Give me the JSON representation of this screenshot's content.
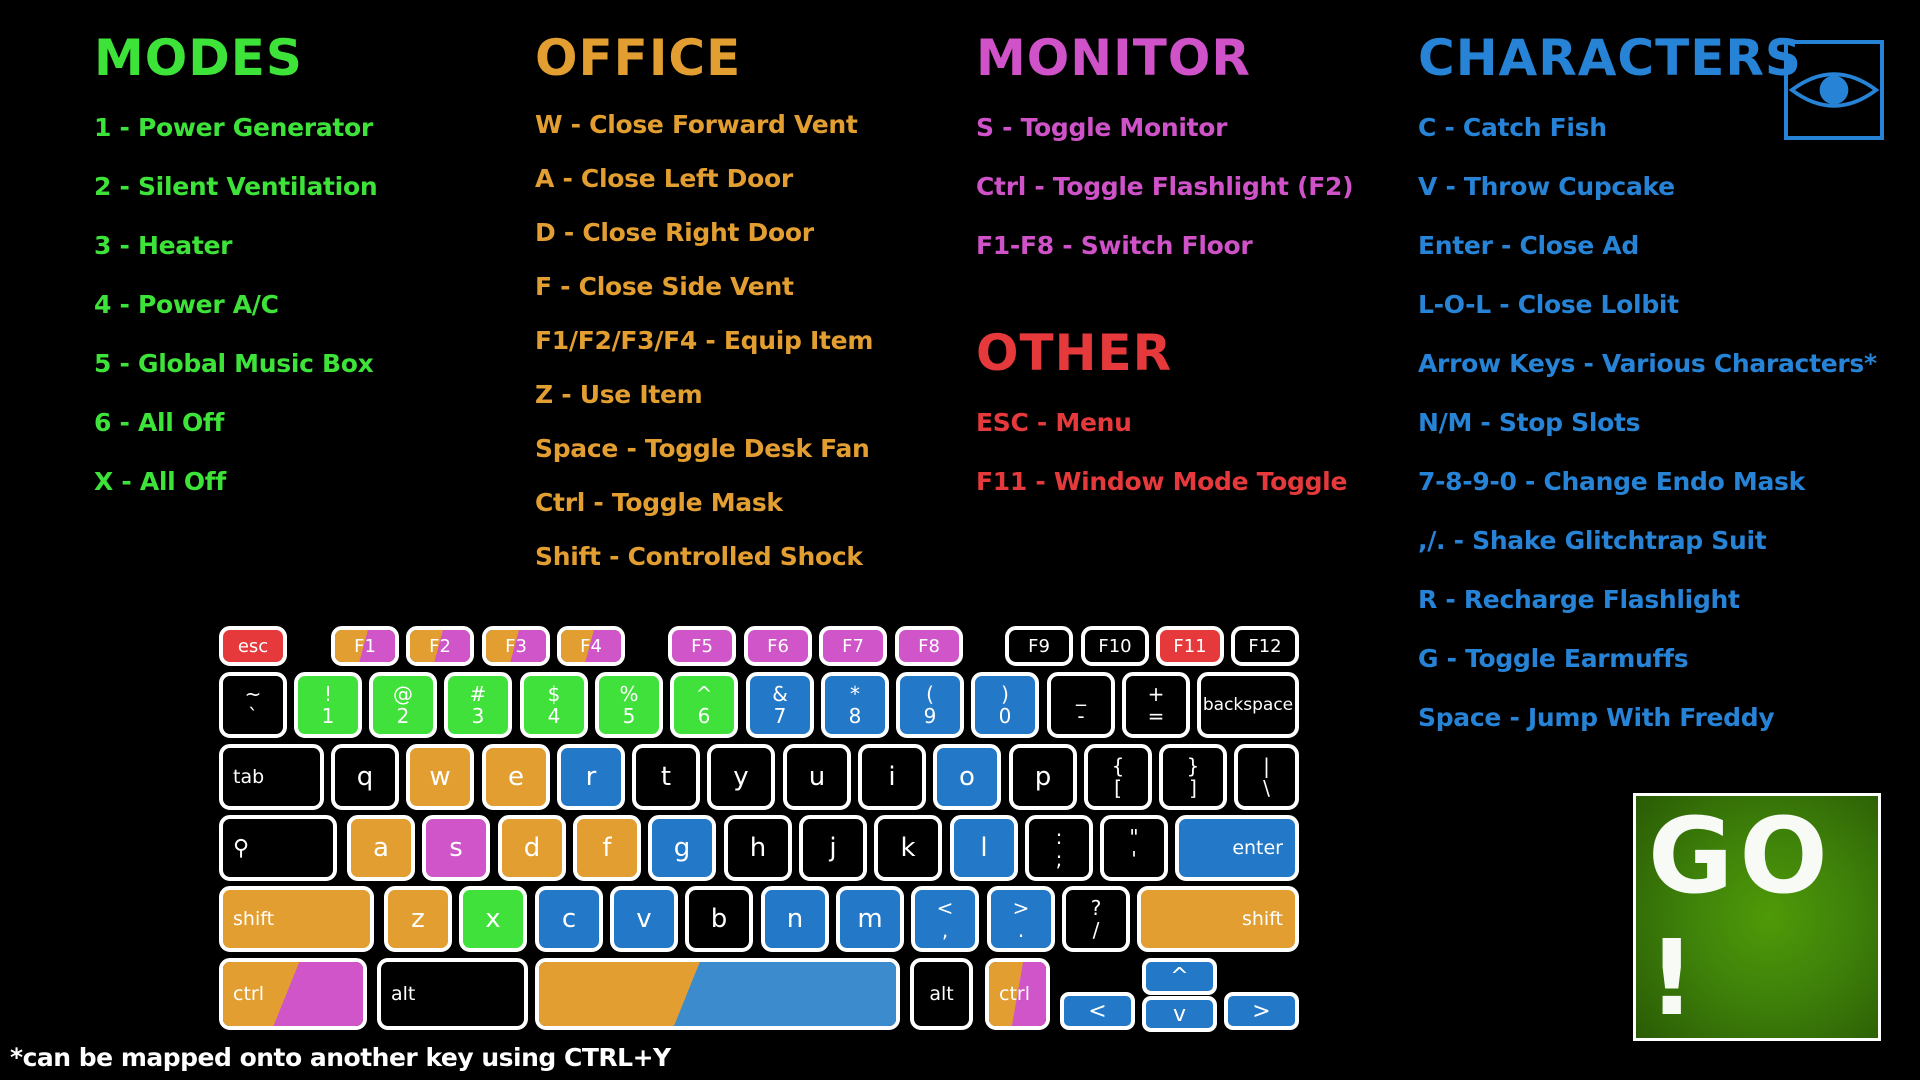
{
  "colors": {
    "modes": "#3ee33a",
    "office": "#e29e30",
    "monitor": "#cf52c8",
    "other": "#e5393c",
    "characters": "#2683d6",
    "key_green": "#41e13b",
    "key_orange": "#e29e30",
    "key_magenta": "#cf55c8",
    "key_blue": "#2379c8",
    "key_red": "#e5393c",
    "space_blue": "#3c8ccd"
  },
  "sections": {
    "modes": {
      "title": "MODES",
      "items": [
        "1 - Power Generator",
        "2 - Silent Ventilation",
        "3 - Heater",
        "4 - Power A/C",
        "5 - Global Music Box",
        "6 - All Off",
        "X - All Off"
      ]
    },
    "office": {
      "title": "OFFICE",
      "items": [
        "W - Close Forward Vent",
        "A - Close Left Door",
        "D - Close Right Door",
        "F - Close Side Vent",
        "F1/F2/F3/F4 - Equip Item",
        "Z - Use Item",
        "Space - Toggle Desk Fan",
        "Ctrl - Toggle Mask",
        "Shift - Controlled Shock"
      ]
    },
    "monitor": {
      "title": "MONITOR",
      "items": [
        "S - Toggle Monitor",
        "Ctrl - Toggle Flashlight (F2)",
        "F1-F8 - Switch Floor"
      ]
    },
    "other": {
      "title": "OTHER",
      "items": [
        "ESC - Menu",
        "F11 - Window Mode Toggle"
      ]
    },
    "characters": {
      "title": "CHARACTERS",
      "items": [
        "C - Catch Fish",
        "V - Throw Cupcake",
        "Enter - Close Ad",
        "L-O-L - Close Lolbit",
        "Arrow Keys - Various Characters*",
        "N/M - Stop Slots",
        "7-8-9-0 - Change Endo Mask",
        ",/.  - Shake Glitchtrap Suit",
        "R - Recharge Flashlight",
        "G - Toggle Earmuffs",
        "Space - Jump With Freddy"
      ]
    }
  },
  "eye_button": {
    "icon": "eye-icon"
  },
  "go_button": {
    "label": "GO !"
  },
  "footnote": "*can be mapped onto another key using CTRL+Y",
  "keyboard": {
    "rows": [
      [
        {
          "id": "esc",
          "label": "esc",
          "color": "red"
        },
        {
          "id": "f1",
          "label": "F1",
          "split": [
            "orange",
            "magenta"
          ]
        },
        {
          "id": "f2",
          "label": "F2",
          "split": [
            "orange",
            "magenta"
          ]
        },
        {
          "id": "f3",
          "label": "F3",
          "split": [
            "orange",
            "magenta"
          ]
        },
        {
          "id": "f4",
          "label": "F4",
          "split": [
            "orange",
            "magenta"
          ]
        },
        {
          "id": "f5",
          "label": "F5",
          "color": "magenta"
        },
        {
          "id": "f6",
          "label": "F6",
          "color": "magenta"
        },
        {
          "id": "f7",
          "label": "F7",
          "color": "magenta"
        },
        {
          "id": "f8",
          "label": "F8",
          "color": "magenta"
        },
        {
          "id": "f9",
          "label": "F9",
          "color": "black"
        },
        {
          "id": "f10",
          "label": "F10",
          "color": "black"
        },
        {
          "id": "f11",
          "label": "F11",
          "color": "red"
        },
        {
          "id": "f12",
          "label": "F12",
          "color": "black"
        }
      ],
      [
        {
          "id": "backtick",
          "top": "~",
          "bottom": "`",
          "color": "black"
        },
        {
          "id": "1",
          "top": "!",
          "bottom": "1",
          "color": "green"
        },
        {
          "id": "2",
          "top": "@",
          "bottom": "2",
          "color": "green"
        },
        {
          "id": "3",
          "top": "#",
          "bottom": "3",
          "color": "green"
        },
        {
          "id": "4",
          "top": "$",
          "bottom": "4",
          "color": "green"
        },
        {
          "id": "5",
          "top": "%",
          "bottom": "5",
          "color": "green"
        },
        {
          "id": "6",
          "top": "^",
          "bottom": "6",
          "color": "green"
        },
        {
          "id": "7",
          "top": "&",
          "bottom": "7",
          "color": "blue"
        },
        {
          "id": "8",
          "top": "*",
          "bottom": "8",
          "color": "blue"
        },
        {
          "id": "9",
          "top": "(",
          "bottom": "9",
          "color": "blue"
        },
        {
          "id": "0",
          "top": ")",
          "bottom": "0",
          "color": "blue"
        },
        {
          "id": "minus",
          "top": "_",
          "bottom": "-",
          "color": "black"
        },
        {
          "id": "equals",
          "top": "+",
          "bottom": "=",
          "color": "black"
        },
        {
          "id": "backspace",
          "label": "backspace",
          "color": "black"
        }
      ],
      [
        {
          "id": "tab",
          "label": "tab",
          "color": "black"
        },
        {
          "id": "q",
          "label": "q",
          "color": "black"
        },
        {
          "id": "w",
          "label": "w",
          "color": "orange"
        },
        {
          "id": "e",
          "label": "e",
          "color": "orange"
        },
        {
          "id": "r",
          "label": "r",
          "color": "blue"
        },
        {
          "id": "t",
          "label": "t",
          "color": "black"
        },
        {
          "id": "y",
          "label": "y",
          "color": "black"
        },
        {
          "id": "u",
          "label": "u",
          "color": "black"
        },
        {
          "id": "i",
          "label": "i",
          "color": "black"
        },
        {
          "id": "o",
          "label": "o",
          "color": "blue"
        },
        {
          "id": "p",
          "label": "p",
          "color": "black"
        },
        {
          "id": "lbracket",
          "top": "{",
          "bottom": "[",
          "color": "black"
        },
        {
          "id": "rbracket",
          "top": "}",
          "bottom": "]",
          "color": "black"
        },
        {
          "id": "backslash",
          "top": "|",
          "bottom": "\\",
          "color": "black"
        }
      ],
      [
        {
          "id": "search",
          "label": "⚲",
          "color": "black"
        },
        {
          "id": "a",
          "label": "a",
          "color": "orange"
        },
        {
          "id": "s",
          "label": "s",
          "color": "magenta"
        },
        {
          "id": "d",
          "label": "d",
          "color": "orange"
        },
        {
          "id": "f",
          "label": "f",
          "color": "orange"
        },
        {
          "id": "g",
          "label": "g",
          "color": "blue"
        },
        {
          "id": "h",
          "label": "h",
          "color": "black"
        },
        {
          "id": "j",
          "label": "j",
          "color": "black"
        },
        {
          "id": "k",
          "label": "k",
          "color": "black"
        },
        {
          "id": "l",
          "label": "l",
          "color": "blue"
        },
        {
          "id": "semicolon",
          "top": ":",
          "bottom": ";",
          "color": "black"
        },
        {
          "id": "quote",
          "top": "\"",
          "bottom": "'",
          "color": "black"
        },
        {
          "id": "enter",
          "label": "enter",
          "color": "blue"
        }
      ],
      [
        {
          "id": "lshift",
          "label": "shift",
          "color": "orange"
        },
        {
          "id": "z",
          "label": "z",
          "color": "orange"
        },
        {
          "id": "x",
          "label": "x",
          "color": "green"
        },
        {
          "id": "c",
          "label": "c",
          "color": "blue"
        },
        {
          "id": "v",
          "label": "v",
          "color": "blue"
        },
        {
          "id": "b",
          "label": "b",
          "color": "black"
        },
        {
          "id": "n",
          "label": "n",
          "color": "blue"
        },
        {
          "id": "m",
          "label": "m",
          "color": "blue"
        },
        {
          "id": "comma",
          "top": "<",
          "bottom": ",",
          "color": "blue"
        },
        {
          "id": "period",
          "top": ">",
          "bottom": ".",
          "color": "blue"
        },
        {
          "id": "slash",
          "top": "?",
          "bottom": "/",
          "color": "black"
        },
        {
          "id": "rshift",
          "label": "shift",
          "color": "orange"
        }
      ],
      [
        {
          "id": "lctrl",
          "label": "ctrl",
          "split": [
            "orange",
            "magenta"
          ]
        },
        {
          "id": "lalt",
          "label": "alt",
          "color": "black"
        },
        {
          "id": "space",
          "label": "",
          "split": [
            "orange",
            "space_blue"
          ]
        },
        {
          "id": "ralt",
          "label": "alt",
          "color": "black"
        },
        {
          "id": "rctrl",
          "label": "ctrl",
          "split": [
            "orange",
            "magenta"
          ]
        },
        {
          "id": "left",
          "label": "<",
          "color": "blue"
        },
        {
          "id": "up",
          "label": "^",
          "color": "blue"
        },
        {
          "id": "down",
          "label": "v",
          "color": "blue"
        },
        {
          "id": "right",
          "label": ">",
          "color": "blue"
        }
      ]
    ]
  }
}
